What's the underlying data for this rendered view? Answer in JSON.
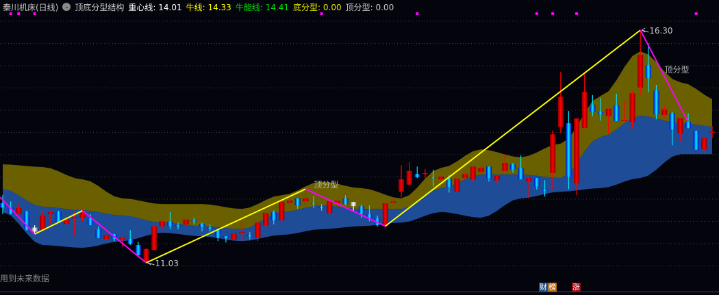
{
  "header": {
    "title": "秦川机床(日线)",
    "indicator_name": "顶底分型结构",
    "zhongxin": "重心线: 14.01",
    "niuxian": "牛线: 14.33",
    "niuneng": "牛能线: 14.41",
    "difenxing": "底分型: 0.00",
    "dingfenxing": "顶分型: 0.00"
  },
  "footer": {
    "note": "用到未来数据",
    "badge_cai": "财",
    "badge_bang": "榜",
    "badge_zhang": "涨"
  },
  "colors": {
    "up": "#ff0000",
    "down": "#00e5ff",
    "upper_band": "#6b6000",
    "lower_band": "#1e4c96",
    "zigzag_up": "#ffff00",
    "zigzag_down": "#ff00ff",
    "signal_dot": "#ff00ff"
  },
  "chart_data": {
    "type": "candlestick",
    "ylim": [
      10.5,
      16.6
    ],
    "candles_ohlc": [
      [
        12.38,
        12.56,
        12.13,
        12.28
      ],
      [
        12.28,
        12.42,
        12.13,
        12.14
      ],
      [
        12.13,
        12.38,
        12.13,
        12.27
      ],
      [
        12.19,
        12.21,
        11.77,
        11.77
      ],
      [
        11.78,
        11.88,
        11.68,
        11.78
      ],
      [
        11.77,
        12.21,
        11.77,
        12.1
      ],
      [
        12.13,
        12.21,
        11.9,
        12.18
      ],
      [
        12.18,
        12.21,
        11.93,
        11.93
      ],
      [
        11.91,
        12.07,
        11.91,
        12.01
      ],
      [
        12.04,
        12.21,
        11.63,
        12.07
      ],
      [
        12.05,
        12.25,
        11.97,
        12.16
      ],
      [
        12.05,
        12.13,
        11.88,
        11.88
      ],
      [
        11.79,
        11.86,
        11.59,
        11.59
      ],
      [
        11.57,
        11.66,
        11.57,
        11.66
      ],
      [
        11.68,
        11.68,
        11.51,
        11.57
      ],
      [
        11.56,
        11.62,
        11.4,
        11.6
      ],
      [
        11.57,
        11.77,
        11.43,
        11.46
      ],
      [
        11.43,
        11.51,
        11.15,
        11.2
      ],
      [
        11.07,
        11.37,
        11.03,
        11.34
      ],
      [
        11.32,
        11.88,
        11.32,
        11.86
      ],
      [
        11.86,
        12.02,
        11.76,
        11.97
      ],
      [
        11.97,
        12.18,
        11.79,
        11.86
      ],
      [
        11.88,
        11.94,
        11.79,
        11.86
      ],
      [
        11.9,
        12.01,
        11.86,
        12.01
      ],
      [
        11.99,
        12.05,
        11.9,
        11.97
      ],
      [
        11.91,
        11.94,
        11.74,
        11.85
      ],
      [
        11.83,
        11.9,
        11.74,
        11.8
      ],
      [
        11.79,
        11.79,
        11.52,
        11.59
      ],
      [
        11.63,
        11.63,
        11.49,
        11.59
      ],
      [
        11.56,
        11.69,
        11.56,
        11.69
      ],
      [
        11.71,
        11.97,
        11.52,
        11.73
      ],
      [
        11.66,
        11.73,
        11.56,
        11.63
      ],
      [
        11.59,
        11.97,
        11.52,
        11.94
      ],
      [
        11.88,
        12.24,
        11.79,
        12.16
      ],
      [
        12.18,
        12.22,
        11.9,
        11.99
      ],
      [
        11.99,
        12.49,
        11.93,
        12.41
      ],
      [
        12.39,
        12.49,
        12.25,
        12.44
      ],
      [
        12.49,
        12.49,
        12.25,
        12.33
      ],
      [
        12.42,
        12.72,
        12.33,
        12.49
      ],
      [
        12.39,
        12.54,
        12.27,
        12.38
      ],
      [
        12.3,
        12.36,
        12.21,
        12.27
      ],
      [
        12.16,
        12.45,
        12.16,
        12.42
      ],
      [
        12.38,
        12.49,
        12.3,
        12.44
      ],
      [
        12.49,
        12.56,
        12.33,
        12.36
      ],
      [
        12.36,
        12.38,
        12.21,
        12.36
      ],
      [
        12.31,
        12.35,
        12.05,
        12.13
      ],
      [
        12.13,
        12.33,
        11.97,
        12.02
      ],
      [
        12.04,
        12.1,
        11.85,
        11.88
      ],
      [
        11.86,
        12.41,
        11.83,
        12.38
      ],
      [
        12.39,
        12.51,
        12.33,
        12.42
      ],
      [
        12.64,
        13.24,
        12.51,
        12.92
      ],
      [
        12.8,
        13.31,
        12.8,
        13.11
      ],
      [
        13.04,
        13.21,
        12.95,
        12.97
      ],
      [
        13.04,
        13.15,
        12.94,
        13.06
      ],
      [
        12.97,
        13.14,
        12.76,
        12.95
      ],
      [
        12.92,
        13.0,
        12.86,
        12.98
      ],
      [
        12.94,
        13.01,
        12.62,
        12.75
      ],
      [
        12.64,
        12.94,
        12.64,
        12.94
      ],
      [
        12.95,
        13.07,
        12.92,
        13.04
      ],
      [
        12.92,
        13.21,
        12.86,
        13.21
      ],
      [
        13.09,
        13.24,
        13.04,
        13.18
      ],
      [
        13.21,
        13.21,
        12.87,
        12.95
      ],
      [
        12.9,
        13.0,
        12.83,
        13.0
      ],
      [
        13.11,
        13.49,
        13.11,
        13.29
      ],
      [
        13.26,
        13.29,
        13.07,
        13.15
      ],
      [
        13.18,
        13.46,
        12.92,
        12.92
      ],
      [
        12.87,
        12.95,
        12.49,
        12.95
      ],
      [
        12.95,
        12.95,
        12.69,
        12.76
      ],
      [
        12.68,
        12.9,
        12.53,
        12.67
      ],
      [
        13.06,
        14.03,
        12.67,
        13.94
      ],
      [
        14.11,
        15.35,
        13.97,
        14.79
      ],
      [
        14.19,
        14.47,
        12.7,
        12.98
      ],
      [
        12.83,
        14.3,
        12.56,
        14.3
      ],
      [
        14.08,
        15.32,
        14.08,
        14.9
      ],
      [
        14.61,
        14.83,
        14.35,
        14.45
      ],
      [
        14.45,
        14.76,
        14.25,
        14.39
      ],
      [
        14.36,
        14.52,
        13.96,
        14.52
      ],
      [
        14.59,
        14.86,
        14.24,
        14.24
      ],
      [
        14.24,
        14.7,
        14.24,
        14.27
      ],
      [
        14.22,
        14.93,
        14.07,
        14.87
      ],
      [
        15.0,
        16.3,
        14.84,
        15.74
      ],
      [
        15.51,
        16.0,
        14.89,
        15.21
      ],
      [
        14.93,
        15.06,
        14.28,
        14.39
      ],
      [
        14.38,
        14.59,
        14.31,
        14.5
      ],
      [
        14.42,
        14.44,
        13.69,
        14.05
      ],
      [
        13.96,
        14.31,
        13.77,
        14.31
      ],
      [
        14.22,
        14.42,
        14.08,
        14.08
      ],
      [
        14.02,
        14.02,
        13.59,
        13.59
      ],
      [
        13.6,
        13.86,
        13.54,
        13.86
      ],
      [
        13.99,
        14.13,
        13.85,
        14.0
      ]
    ],
    "band_sample_every": 5,
    "band_upper": [
      13.26,
      13.2,
      12.92,
      12.49,
      12.36,
      12.36,
      12.25,
      12.56,
      12.87,
      12.72,
      12.49,
      13.18,
      13.6,
      13.42,
      13.73,
      14.81,
      15.82,
      15.12,
      14.69
    ],
    "band_mid": [
      12.7,
      12.3,
      12.22,
      12.1,
      11.94,
      11.86,
      11.79,
      12.18,
      12.33,
      12.25,
      12.25,
      12.72,
      13.03,
      13.03,
      12.95,
      13.88,
      14.36,
      14.19,
      14.1
    ],
    "band_lower": [
      12.18,
      11.43,
      11.37,
      11.52,
      11.71,
      11.63,
      11.52,
      11.66,
      11.79,
      11.86,
      11.94,
      12.18,
      12.05,
      12.49,
      12.64,
      12.72,
      12.95,
      13.49,
      13.49
    ],
    "zigzag_pivots": [
      [
        0,
        12.52
      ],
      [
        4,
        11.68
      ],
      [
        10,
        12.21
      ],
      [
        18,
        11.03
      ],
      [
        38,
        12.7
      ],
      [
        48,
        11.86
      ],
      [
        80,
        16.3
      ],
      [
        86,
        14.22
      ]
    ],
    "signal_dot_indices": [
      1,
      2,
      4,
      40,
      52,
      67,
      69,
      72,
      87
    ],
    "annotations": [
      {
        "text": "顶分型",
        "index": 38,
        "price": 12.8
      },
      {
        "text": "顶分型",
        "index": 82,
        "price": 15.4
      },
      {
        "text": "11.03",
        "index": 18,
        "price": 11.03,
        "arrow": true
      },
      {
        "text": "16.30",
        "index": 80,
        "price": 16.3,
        "arrow": true
      }
    ]
  }
}
